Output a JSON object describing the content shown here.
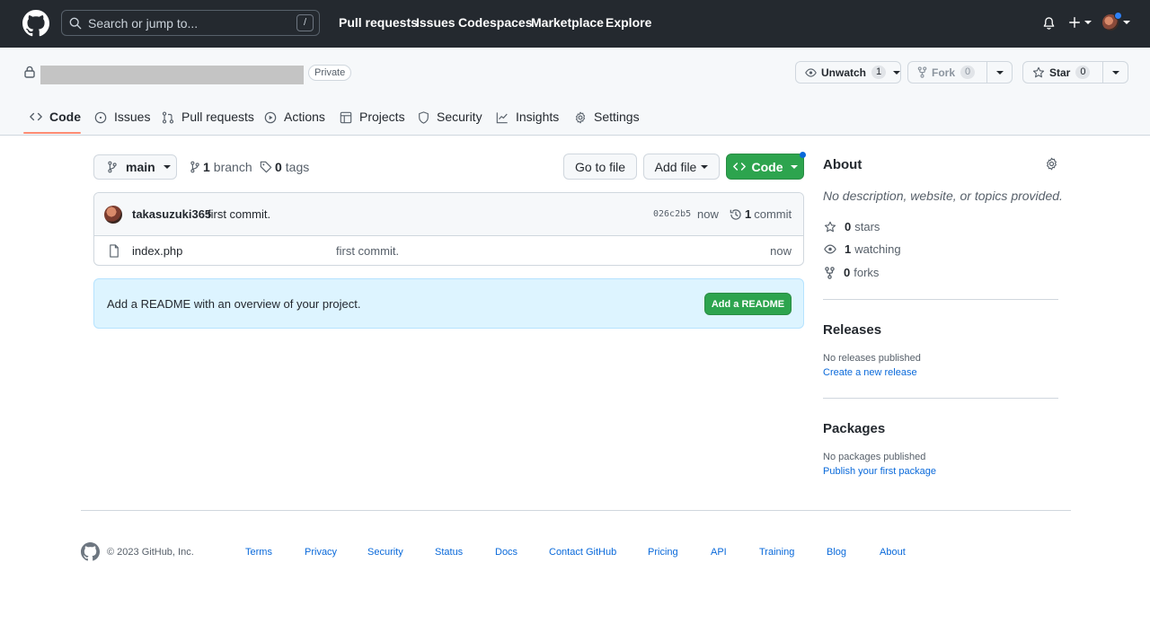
{
  "header": {
    "search_placeholder": "Search or jump to...",
    "search_shortcut": "/",
    "nav": [
      "Pull requests",
      "Issues",
      "Codespaces",
      "Marketplace",
      "Explore"
    ]
  },
  "repo": {
    "visibility": "Private",
    "watch": {
      "label": "Unwatch",
      "count": "1"
    },
    "fork": {
      "label": "Fork",
      "count": "0"
    },
    "star": {
      "label": "Star",
      "count": "0"
    },
    "tabs": [
      "Code",
      "Issues",
      "Pull requests",
      "Actions",
      "Projects",
      "Security",
      "Insights",
      "Settings"
    ],
    "active_tab": "Code"
  },
  "main": {
    "branch": "main",
    "branches_count": "1",
    "branches_label": "branch",
    "tags_count": "0",
    "tags_label": "tags",
    "go_to_file": "Go to file",
    "add_file": "Add file",
    "code_button": "Code",
    "commit": {
      "author": "takasuzuki365",
      "message": "first commit.",
      "sha": "026c2b5",
      "time": "now",
      "count": "1",
      "count_label": "commit"
    },
    "files": [
      {
        "name": "index.php",
        "message": "first commit.",
        "age": "now"
      }
    ],
    "readme_prompt": "Add a README with an overview of your project.",
    "readme_button": "Add a README"
  },
  "sidebar": {
    "about_title": "About",
    "about_desc": "No description, website, or topics provided.",
    "stars_count": "0",
    "stars_label": "stars",
    "watching_count": "1",
    "watching_label": "watching",
    "forks_count": "0",
    "forks_label": "forks",
    "releases_title": "Releases",
    "releases_none": "No releases published",
    "releases_link": "Create a new release",
    "packages_title": "Packages",
    "packages_none": "No packages published",
    "packages_link": "Publish your first package"
  },
  "footer": {
    "copyright": "© 2023 GitHub, Inc.",
    "links": [
      "Terms",
      "Privacy",
      "Security",
      "Status",
      "Docs",
      "Contact GitHub",
      "Pricing",
      "API",
      "Training",
      "Blog",
      "About"
    ]
  },
  "colors": {
    "header_bg": "#24292f",
    "green": "#2da44e",
    "link": "#0969da",
    "tab_underline": "#fd8c73",
    "readme_bg": "#ddf4ff"
  }
}
